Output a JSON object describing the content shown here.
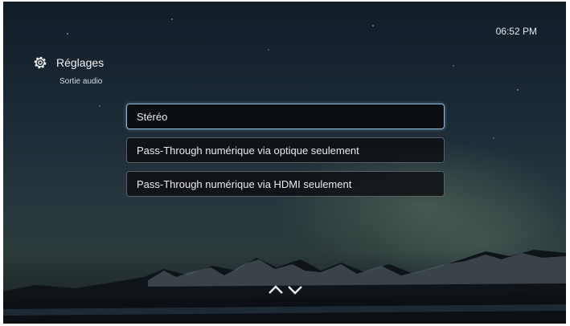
{
  "status": {
    "time": "06:52 PM"
  },
  "header": {
    "title": "Réglages",
    "subtitle": "Sortie audio",
    "icon": "gear-icon"
  },
  "menu": {
    "items": [
      {
        "label": "Stéréo",
        "selected": true
      },
      {
        "label": "Pass-Through numérique via optique seulement",
        "selected": false
      },
      {
        "label": "Pass-Through numérique via HDMI seulement",
        "selected": false
      }
    ]
  },
  "navigation": {
    "icons": [
      "chevron-up-icon",
      "chevron-down-icon"
    ]
  },
  "colors": {
    "selection_border": "#8fb8d8",
    "item_background": "#0a0c0e",
    "text": "#e9ecec"
  }
}
